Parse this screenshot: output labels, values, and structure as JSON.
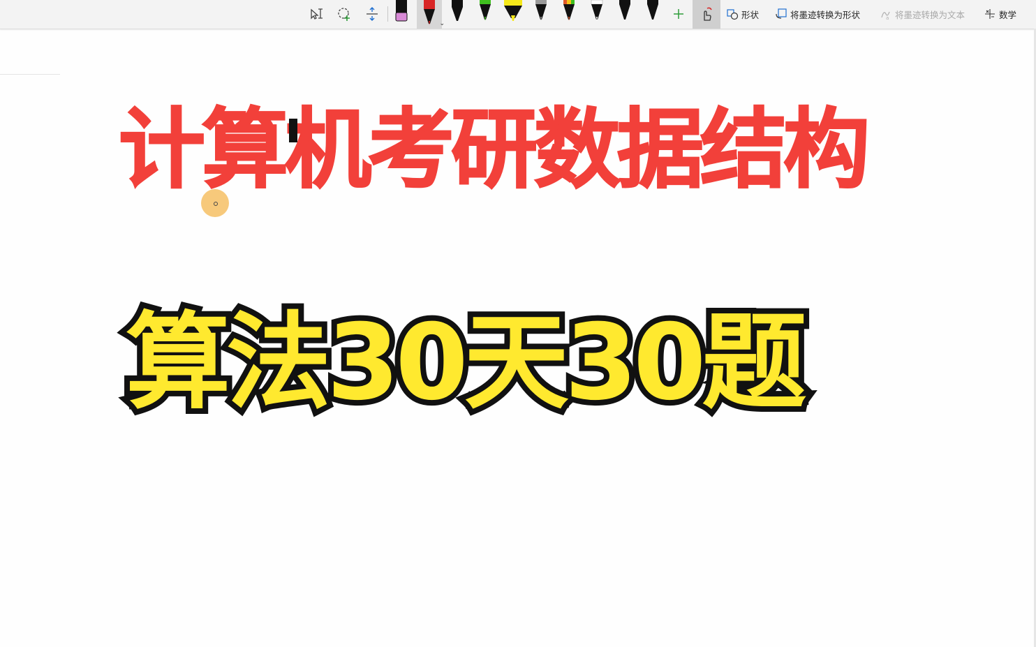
{
  "toolbar": {
    "tools": [
      "lasso-select-text-icon",
      "lasso-select-icon",
      "add-space-icon"
    ],
    "pens": [
      {
        "name": "pen-black-pink",
        "color": "#111111",
        "accent": "#d88ad6"
      },
      {
        "name": "pen-red",
        "color": "#d82525",
        "selected": true
      },
      {
        "name": "pen-black",
        "color": "#111111"
      },
      {
        "name": "pen-green",
        "color": "#3fbf1f"
      },
      {
        "name": "highlighter-yellow",
        "color": "#f5e81a"
      },
      {
        "name": "pencil-gray",
        "color": "#9a9a9a"
      },
      {
        "name": "pen-rainbow",
        "color": "#e05a2a"
      },
      {
        "name": "pen-white",
        "color": "#ffffff"
      },
      {
        "name": "pen-black-2",
        "color": "#111111"
      },
      {
        "name": "pen-black-3",
        "color": "#111111"
      }
    ],
    "shape_label": "形状",
    "ink_to_shape_label": "将墨迹转换为形状",
    "ink_to_text_label": "将墨迹转换为文本",
    "math_label": "数学"
  },
  "content": {
    "title": "计算机考研数据结构",
    "subtitle": "算法30天30题"
  },
  "colors": {
    "title_red": "#f2403a",
    "subtitle_yellow": "#ffe92f",
    "outline": "#111111",
    "cursor": "#f7c46d"
  }
}
